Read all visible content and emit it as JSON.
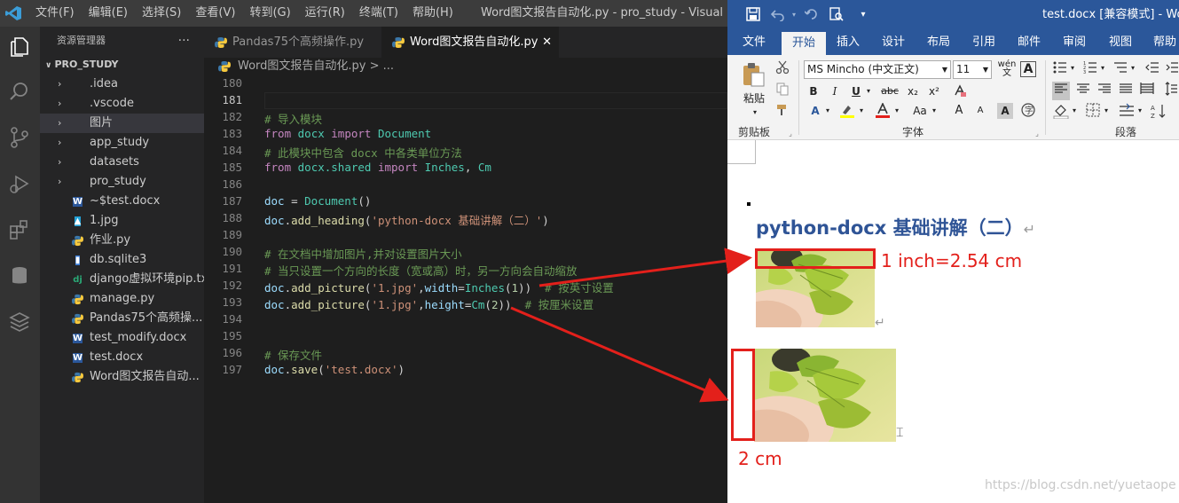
{
  "vscode": {
    "menu": [
      "文件(F)",
      "编辑(E)",
      "选择(S)",
      "查看(V)",
      "转到(G)",
      "运行(R)",
      "终端(T)",
      "帮助(H)"
    ],
    "window_title": "Word图文报告自动化.py - pro_study - Visual Studio C",
    "explorer": {
      "title": "资源管理器",
      "more": "···",
      "project": "PRO_STUDY",
      "items": [
        {
          "type": "folder",
          "label": ".idea",
          "icon": "folder-icon"
        },
        {
          "type": "folder",
          "label": ".vscode",
          "icon": "folder-icon"
        },
        {
          "type": "folder",
          "label": "图片",
          "icon": "folder-icon",
          "selected": true
        },
        {
          "type": "folder",
          "label": "app_study",
          "icon": "folder-icon"
        },
        {
          "type": "folder",
          "label": "datasets",
          "icon": "folder-icon"
        },
        {
          "type": "folder",
          "label": "pro_study",
          "icon": "folder-icon"
        },
        {
          "type": "file",
          "label": "~$test.docx",
          "icon": "word-file-icon"
        },
        {
          "type": "file",
          "label": "1.jpg",
          "icon": "image-file-icon"
        },
        {
          "type": "file",
          "label": "作业.py",
          "icon": "python-file-icon"
        },
        {
          "type": "file",
          "label": "db.sqlite3",
          "icon": "database-file-icon"
        },
        {
          "type": "file",
          "label": "django虚拟环境pip.txt",
          "icon": "django-file-icon"
        },
        {
          "type": "file",
          "label": "manage.py",
          "icon": "python-file-icon"
        },
        {
          "type": "file",
          "label": "Pandas75个高频操...",
          "icon": "python-file-icon"
        },
        {
          "type": "file",
          "label": "test_modify.docx",
          "icon": "word-file-icon"
        },
        {
          "type": "file",
          "label": "test.docx",
          "icon": "word-file-icon"
        },
        {
          "type": "file",
          "label": "Word图文报告自动...",
          "icon": "python-file-icon"
        }
      ]
    },
    "tabs": [
      {
        "label": "Pandas75个高频操作.py",
        "active": false
      },
      {
        "label": "Word图文报告自动化.py",
        "active": true,
        "close": "✕"
      }
    ],
    "breadcrumb": "Word图文报告自动化.py > ...",
    "current_line": "181",
    "code_lines": [
      {
        "n": "180",
        "tokens": []
      },
      {
        "n": "181",
        "tokens": []
      },
      {
        "n": "182",
        "tokens": [
          [
            "c",
            "# 导入模块"
          ]
        ]
      },
      {
        "n": "183",
        "tokens": [
          [
            "k",
            "from"
          ],
          [
            "",
            " "
          ],
          [
            "cl",
            "docx"
          ],
          [
            "",
            " "
          ],
          [
            "k",
            "import"
          ],
          [
            "",
            " "
          ],
          [
            "cl",
            "Document"
          ]
        ]
      },
      {
        "n": "184",
        "tokens": [
          [
            "c",
            "# 此模块中包含 docx 中各类单位方法"
          ]
        ]
      },
      {
        "n": "185",
        "tokens": [
          [
            "k",
            "from"
          ],
          [
            "",
            " "
          ],
          [
            "cl",
            "docx.shared"
          ],
          [
            "",
            " "
          ],
          [
            "k",
            "import"
          ],
          [
            "",
            " "
          ],
          [
            "cl",
            "Inches"
          ],
          [
            "",
            ", "
          ],
          [
            "cl",
            "Cm"
          ]
        ]
      },
      {
        "n": "186",
        "tokens": []
      },
      {
        "n": "187",
        "tokens": [
          [
            "v",
            "doc"
          ],
          [
            "",
            " = "
          ],
          [
            "cl",
            "Document"
          ],
          [
            "",
            "()"
          ]
        ]
      },
      {
        "n": "188",
        "tokens": [
          [
            "v",
            "doc"
          ],
          [
            "",
            "."
          ],
          [
            "f",
            "add_heading"
          ],
          [
            "",
            "("
          ],
          [
            "s",
            "'python-docx 基础讲解（二）'"
          ],
          [
            "",
            ")"
          ]
        ]
      },
      {
        "n": "189",
        "tokens": []
      },
      {
        "n": "190",
        "tokens": [
          [
            "c",
            "# 在文档中增加图片,并对设置图片大小"
          ]
        ]
      },
      {
        "n": "191",
        "tokens": [
          [
            "c",
            "# 当只设置一个方向的长度（宽或高）时，另一方向会自动缩放"
          ]
        ]
      },
      {
        "n": "192",
        "tokens": [
          [
            "v",
            "doc"
          ],
          [
            "",
            "."
          ],
          [
            "f",
            "add_picture"
          ],
          [
            "",
            "("
          ],
          [
            "s",
            "'1.jpg'"
          ],
          [
            "",
            ","
          ],
          [
            "v",
            "width"
          ],
          [
            "",
            "="
          ],
          [
            "cl",
            "Inches"
          ],
          [
            "",
            "("
          ],
          [
            "n",
            "1"
          ],
          [
            "",
            "))  "
          ],
          [
            "c",
            "# 按英寸设置"
          ]
        ]
      },
      {
        "n": "193",
        "tokens": [
          [
            "v",
            "doc"
          ],
          [
            "",
            "."
          ],
          [
            "f",
            "add_picture"
          ],
          [
            "",
            "("
          ],
          [
            "s",
            "'1.jpg'"
          ],
          [
            "",
            ","
          ],
          [
            "v",
            "height"
          ],
          [
            "",
            "="
          ],
          [
            "cl",
            "Cm"
          ],
          [
            "",
            "("
          ],
          [
            "n",
            "2"
          ],
          [
            "",
            "))  "
          ],
          [
            "c",
            "# 按厘米设置"
          ]
        ]
      },
      {
        "n": "194",
        "tokens": []
      },
      {
        "n": "195",
        "tokens": []
      },
      {
        "n": "196",
        "tokens": [
          [
            "c",
            "# 保存文件"
          ]
        ]
      },
      {
        "n": "197",
        "tokens": [
          [
            "v",
            "doc"
          ],
          [
            "",
            "."
          ],
          [
            "f",
            "save"
          ],
          [
            "",
            "("
          ],
          [
            "s",
            "'test.docx'"
          ],
          [
            "",
            ")"
          ]
        ]
      }
    ]
  },
  "word": {
    "title": "test.docx [兼容模式] - Wo",
    "tabs": [
      "文件",
      "开始",
      "插入",
      "设计",
      "布局",
      "引用",
      "邮件",
      "审阅",
      "视图",
      "帮助"
    ],
    "active_tab": "开始",
    "ribbon": {
      "paste": "粘贴",
      "clipboard_group": "剪贴板",
      "font_name": "MS Mincho (中文正文)",
      "font_size": "11",
      "font_group": "字体",
      "paragraph_group": "段落",
      "bold": "B",
      "italic": "I",
      "underline": "U",
      "strike": "abc",
      "sub": "x₂",
      "sup": "x²",
      "font_color_a": "A",
      "aa": "Aa",
      "grow": "A",
      "shrink": "A"
    },
    "document": {
      "heading": "python-docx 基础讲解（二）",
      "return_mark": "↵"
    }
  },
  "annotations": {
    "label1": "1 inch=2.54 cm",
    "label2": "2 cm",
    "color": "#e3201b"
  },
  "watermark": "https://blog.csdn.net/yuetaope"
}
